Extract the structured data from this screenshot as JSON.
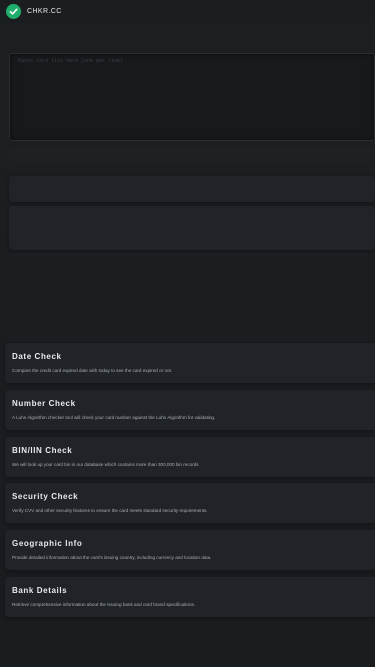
{
  "header": {
    "brand": "CHKR.CC",
    "logo_color": "#1fae6b"
  },
  "input": {
    "placeholder": "Paste card list here (one per line)"
  },
  "features": [
    {
      "title": "Date Check",
      "description": "Compare the credit card expired date with today to see the card expired or not."
    },
    {
      "title": "Number Check",
      "description": "A Luhn Algorithm checker tool will check your card number against the Luhn Algorithm for validating."
    },
    {
      "title": "BIN/IIN Check",
      "description": "We will look up your card bin in our database which contains more than 300,000 bin records"
    },
    {
      "title": "Security Check",
      "description": "Verify CVV and other security features to ensure the card meets standard security requirements."
    },
    {
      "title": "Geographic Info",
      "description": "Provide detailed information about the card's issuing country, including currency and location data."
    },
    {
      "title": "Bank Details",
      "description": "Retrieve comprehensive information about the issuing bank and card brand specifications."
    }
  ]
}
